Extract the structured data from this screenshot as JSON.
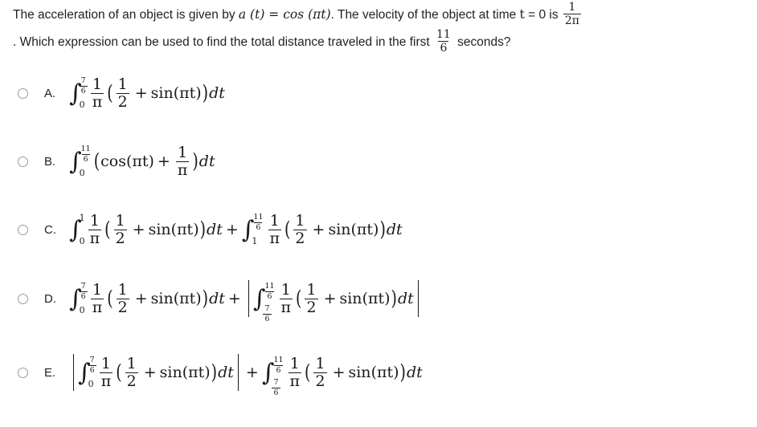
{
  "question": {
    "line1_part1": "The acceleration of an object is given by ",
    "line1_math1": "a (t) = cos (πt)",
    "line1_part2": ". The velocity of the object at time ",
    "line1_math2": "t",
    "line1_part3": " = 0 is ",
    "line1_frac": {
      "num": "1",
      "den": "2π"
    },
    "line2_part1": ". Which expression can be used to find the total distance traveled in the first ",
    "line2_frac": {
      "num": "11",
      "den": "6"
    },
    "line2_part2": " seconds?"
  },
  "integrand": {
    "coef_num": "1",
    "coef_den": "π",
    "inner_num": "1",
    "inner_den": "2",
    "plus": "+",
    "sin": "sin",
    "arg": "(πt)",
    "differential": "dt"
  },
  "symbols": {
    "integral": "∫",
    "open_paren": "(",
    "close_paren": ")",
    "plus": "+",
    "abs_bar": "|",
    "equals": "="
  },
  "choices": [
    {
      "letter": "A.",
      "name": "choice-a",
      "terms": [
        {
          "abs": false,
          "lower": {
            "type": "plain",
            "value": "0"
          },
          "upper": {
            "type": "frac",
            "num": "7",
            "den": "6"
          },
          "integrand": "coef"
        }
      ]
    },
    {
      "letter": "B.",
      "name": "choice-b",
      "terms": [
        {
          "abs": false,
          "lower": {
            "type": "plain",
            "value": "0"
          },
          "upper": {
            "type": "frac",
            "num": "11",
            "den": "6"
          },
          "integrand": "cos"
        }
      ]
    },
    {
      "letter": "C.",
      "name": "choice-c",
      "terms": [
        {
          "abs": false,
          "lower": {
            "type": "plain",
            "value": "0"
          },
          "upper": {
            "type": "plain",
            "value": "1"
          },
          "integrand": "coef"
        },
        {
          "abs": false,
          "lower": {
            "type": "plain",
            "value": "1"
          },
          "upper": {
            "type": "frac",
            "num": "11",
            "den": "6"
          },
          "integrand": "coef"
        }
      ]
    },
    {
      "letter": "D.",
      "name": "choice-d",
      "terms": [
        {
          "abs": false,
          "lower": {
            "type": "plain",
            "value": "0"
          },
          "upper": {
            "type": "frac",
            "num": "7",
            "den": "6"
          },
          "integrand": "coef"
        },
        {
          "abs": true,
          "lower": {
            "type": "frac",
            "num": "7",
            "den": "6"
          },
          "upper": {
            "type": "frac",
            "num": "11",
            "den": "6"
          },
          "integrand": "coef"
        }
      ]
    },
    {
      "letter": "E.",
      "name": "choice-e",
      "terms": [
        {
          "abs": true,
          "lower": {
            "type": "plain",
            "value": "0"
          },
          "upper": {
            "type": "frac",
            "num": "7",
            "den": "6"
          },
          "integrand": "coef"
        },
        {
          "abs": false,
          "lower": {
            "type": "frac",
            "num": "7",
            "den": "6"
          },
          "upper": {
            "type": "frac",
            "num": "11",
            "den": "6"
          },
          "integrand": "coef"
        }
      ]
    }
  ],
  "layout": {
    "choice_tops": [
      96,
      181,
      266,
      352,
      444
    ]
  },
  "colors": {
    "background": "#ffffff",
    "text": "#222222",
    "math": "#1a1a1a",
    "radio_border": "#9a9a9a"
  }
}
